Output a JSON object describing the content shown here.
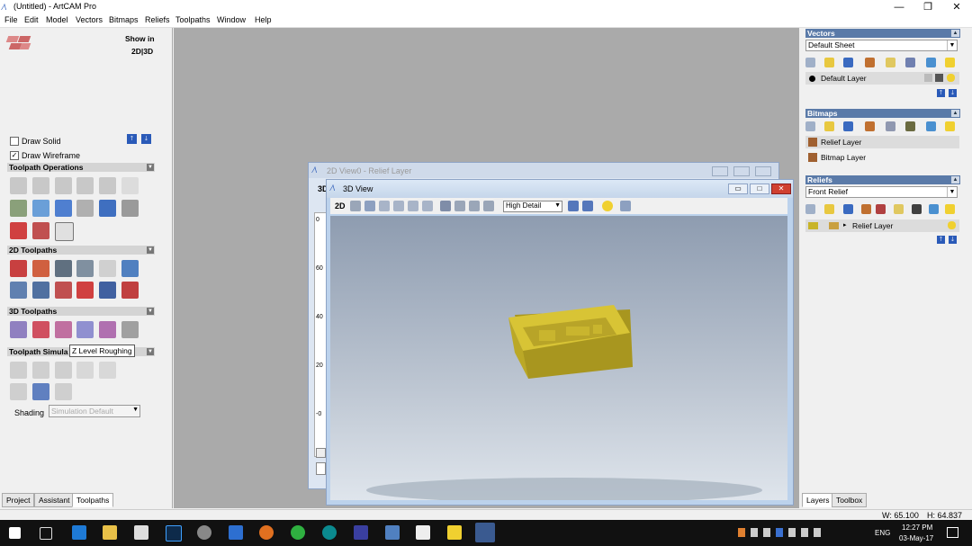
{
  "app": {
    "title": "(Untitled) - ArtCAM Pro",
    "win_minimize": "—",
    "win_restore": "❐",
    "win_close": "✕"
  },
  "menu": [
    "File",
    "Edit",
    "Model",
    "Vectors",
    "Bitmaps",
    "Reliefs",
    "Toolpaths",
    "Window",
    "Help"
  ],
  "left_panel": {
    "show_in_label": "Show in",
    "show_in_value": "2D|3D",
    "draw_solid": "Draw Solid",
    "draw_wireframe": "Draw Wireframe",
    "sections": {
      "toolpath_operations": "Toolpath Operations",
      "toolpaths_2d": "2D Toolpaths",
      "toolpaths_3d": "3D Toolpaths",
      "toolpath_simulation": "Toolpath Simula"
    },
    "tooltip": "Z Level Roughing",
    "shading_label": "Shading",
    "shading_value": "Simulation Default",
    "tabs": [
      "Project",
      "Assistant",
      "Toolpaths"
    ]
  },
  "view2d": {
    "title": "2D View0 - Relief Layer",
    "tab_label": "3D",
    "ruler_ticks": [
      "0",
      "60",
      "40",
      "20",
      "-0"
    ]
  },
  "view3d": {
    "title": "3D View",
    "mode": "2D",
    "detail": "High Detail"
  },
  "right_panel": {
    "vectors": {
      "title": "Vectors",
      "sheet": "Default Sheet",
      "layer": "Default Layer"
    },
    "bitmaps": {
      "title": "Bitmaps",
      "layers": [
        "Relief Layer",
        "Bitmap Layer"
      ]
    },
    "reliefs": {
      "title": "Reliefs",
      "relief": "Front Relief",
      "layer": "Relief Layer"
    },
    "tabs": [
      "Layers",
      "Toolbox"
    ]
  },
  "status": {
    "width": "W: 65.100",
    "height": "H: 64.837"
  },
  "taskbar": {
    "time": "12:27 PM",
    "date": "03-May-17",
    "lang": "ENG"
  },
  "colors": {
    "part_fill": "#c7b22a",
    "part_top": "#d8c435",
    "section_header": "#5a7aa8",
    "workspace_bg": "#aaaaaa"
  }
}
